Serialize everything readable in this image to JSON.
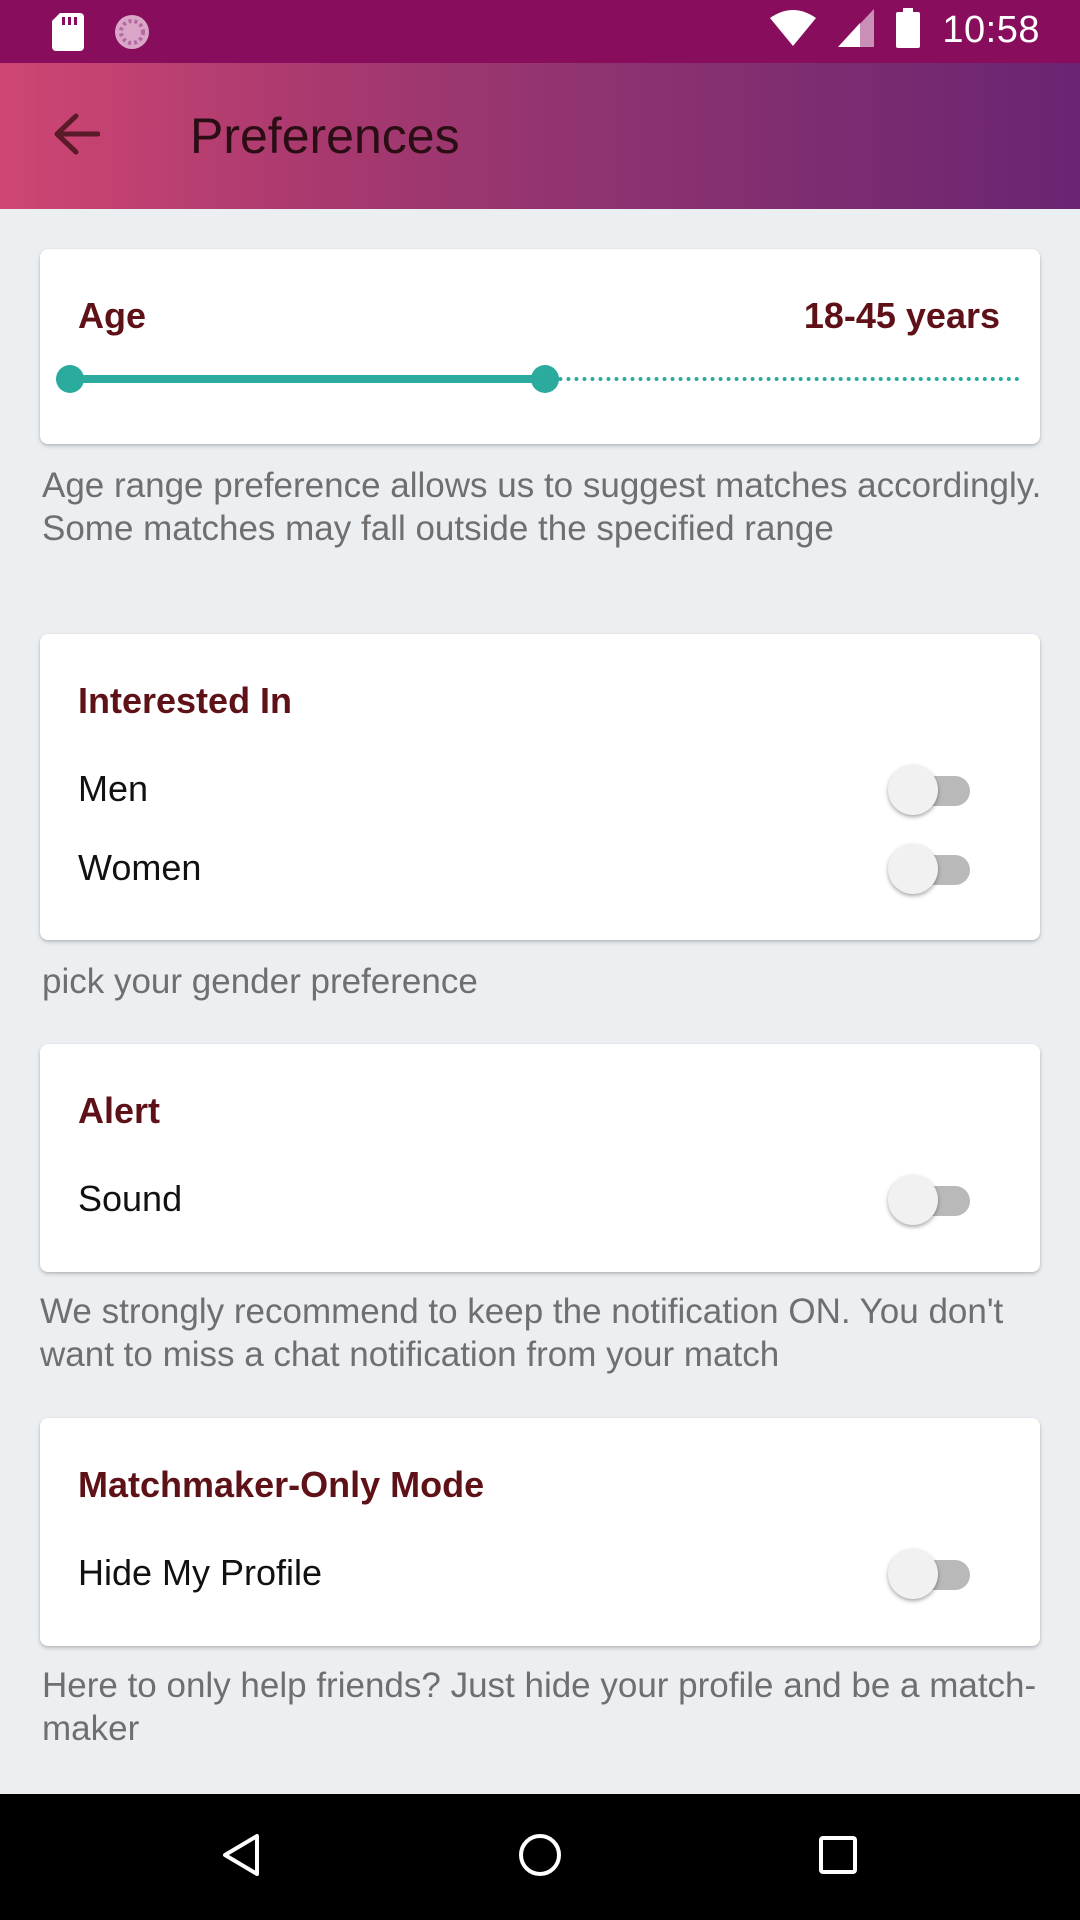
{
  "status_bar": {
    "time": "10:58",
    "icons": [
      "sd-card-icon",
      "loading-icon",
      "wifi-icon",
      "signal-icon",
      "battery-icon"
    ]
  },
  "app_bar": {
    "title": "Preferences",
    "back_icon": "arrow-back-icon"
  },
  "age": {
    "heading": "Age",
    "value": "18-45 years",
    "range_min_fraction": 0.0,
    "range_max_fraction": 0.5,
    "accent_color": "#2bab9d",
    "helper": "Age range preference allows us to suggest matches accordingly. Some matches may fall outside the specified range"
  },
  "interested_in": {
    "heading": "Interested In",
    "rows": [
      {
        "label": "Men",
        "on": false
      },
      {
        "label": "Women",
        "on": false
      }
    ],
    "helper": "pick your gender preference"
  },
  "alert": {
    "heading": "Alert",
    "rows": [
      {
        "label": "Sound",
        "on": false
      }
    ],
    "helper": "We strongly recommend to keep the notification ON. You don't want to miss a chat notification from your match"
  },
  "matchmaker": {
    "heading": "Matchmaker-Only Mode",
    "rows": [
      {
        "label": "Hide My Profile",
        "on": false
      }
    ],
    "helper": "Here to only help friends? Just hide your profile and be a match-maker"
  },
  "nav_bar": {
    "icons": [
      "back-triangle-icon",
      "home-circle-icon",
      "recents-square-icon"
    ]
  },
  "colors": {
    "status_bar": "#880e5d",
    "heading": "#5e1218",
    "helper_text": "#6f6f6f"
  }
}
